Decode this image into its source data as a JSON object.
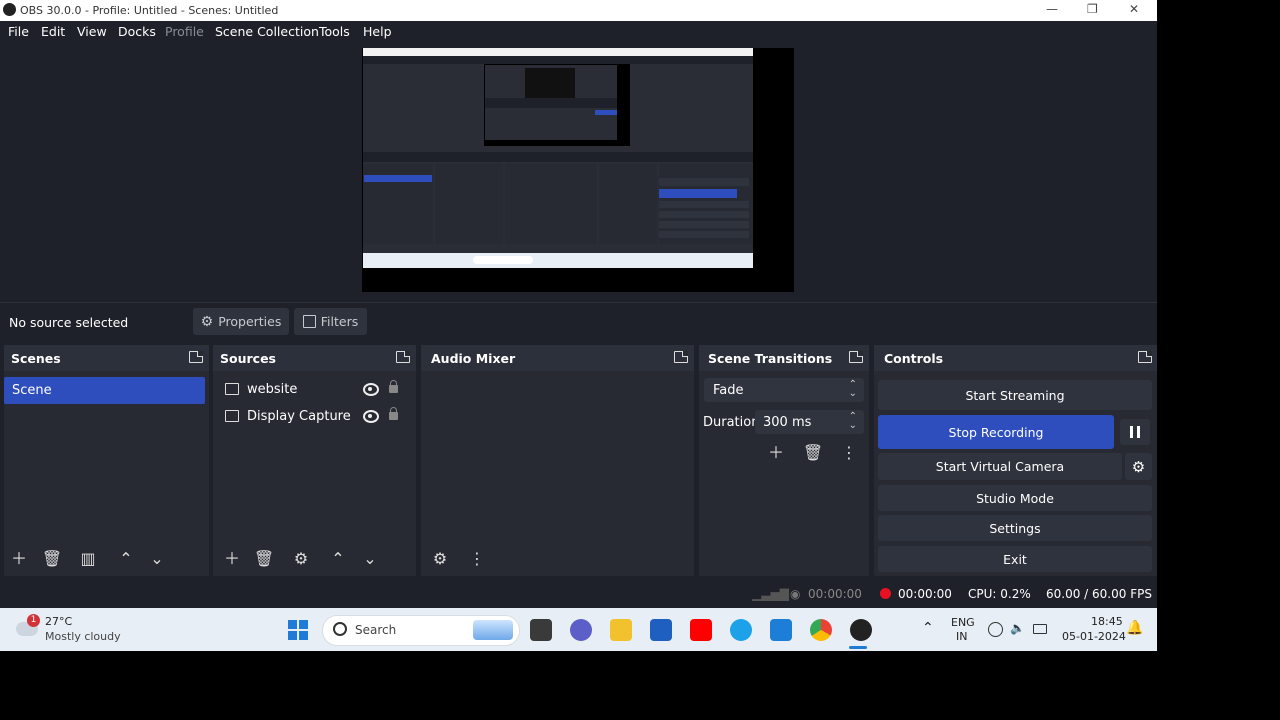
{
  "window": {
    "title": "OBS 30.0.0 - Profile: Untitled - Scenes: Untitled",
    "minimize": "—",
    "maximize": "❐",
    "close": "✕"
  },
  "menu": [
    "File",
    "Edit",
    "View",
    "Docks",
    "Profile",
    "Scene Collection",
    "Tools",
    "Help"
  ],
  "source_bar": {
    "status": "No source selected",
    "properties_label": "Properties",
    "filters_label": "Filters"
  },
  "docks": {
    "scenes": {
      "title": "Scenes",
      "items": [
        "Scene"
      ]
    },
    "sources": {
      "title": "Sources",
      "items": [
        "website",
        "Display Capture"
      ]
    },
    "audio_mixer": {
      "title": "Audio Mixer"
    },
    "transitions": {
      "title": "Scene Transitions",
      "selected": "Fade",
      "duration_label": "Duration",
      "duration_value": "300 ms"
    },
    "controls": {
      "title": "Controls",
      "start_streaming": "Start Streaming",
      "stop_recording": "Stop Recording",
      "start_virtual_camera": "Start Virtual Camera",
      "studio_mode": "Studio Mode",
      "settings": "Settings",
      "exit": "Exit"
    }
  },
  "status": {
    "stream_time": "00:00:00",
    "record_time": "00:00:00",
    "cpu": "CPU: 0.2%",
    "fps": "60.00 / 60.00 FPS"
  },
  "taskbar": {
    "weather_temp": "27°C",
    "weather_desc": "Mostly cloudy",
    "weather_badge": "1",
    "search_placeholder": "Search",
    "lang_top": "ENG",
    "lang_bottom": "IN",
    "time": "18:45",
    "date": "05-01-2024"
  },
  "colors": {
    "accent": "#2f4ebd",
    "record": "#e81123",
    "bg": "#1e2129",
    "dock": "#272a33"
  }
}
